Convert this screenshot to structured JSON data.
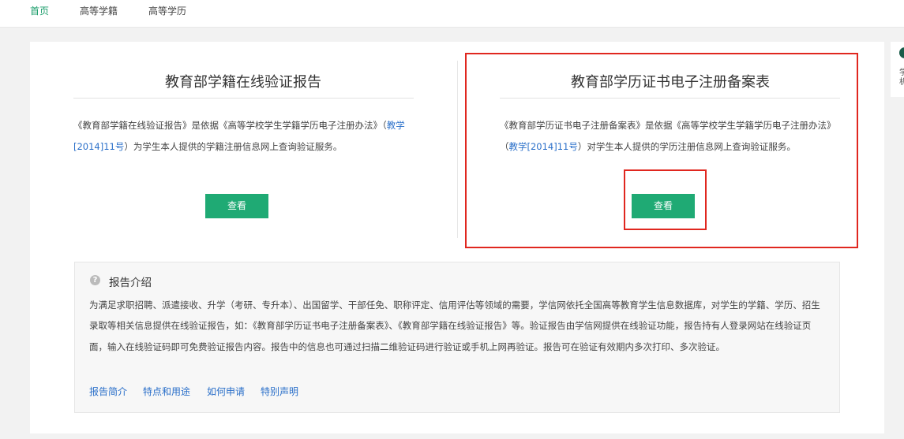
{
  "nav": {
    "items": [
      {
        "label": "首页"
      },
      {
        "label": "高等学籍"
      },
      {
        "label": "高等学历"
      }
    ],
    "active_color": "#1a9c6a"
  },
  "reports": {
    "left": {
      "title": "教育部学籍在线验证报告",
      "desc_pre": "《教育部学籍在线验证报告》是依据《高等学校学生学籍学历电子注册办法》（",
      "desc_link": "教学[2014]11号",
      "desc_post": "）为学生本人提供的学籍注册信息网上查询验证服务。",
      "button": "查看"
    },
    "right": {
      "title": "教育部学历证书电子注册备案表",
      "desc_pre": "《教育部学历证书电子注册备案表》是依据《高等学校学生学籍学历电子注册办法》（",
      "desc_link": "教学[2014]11号",
      "desc_post": "）对学生本人提供的学历注册信息网上查询验证服务。",
      "button": "查看"
    }
  },
  "intro": {
    "heading": "报告介绍",
    "icon": "question-circle-icon",
    "text": "为满足求职招聘、派遣接收、升学（考研、专升本）、出国留学、干部任免、职称评定、信用评估等领域的需要，学信网依托全国高等教育学生信息数据库，对学生的学籍、学历、招生录取等相关信息提供在线验证报告，如：《教育部学历证书电子注册备案表》、《教育部学籍在线验证报告》等。验证报告由学信网提供在线验证功能，报告持有人登录网站在线验证页面，输入在线验证码即可免费验证报告内容。报告中的信息也可通过扫描二维验证码进行验证或手机上网再验证。报告可在验证有效期内多次打印、多次验证。",
    "links": [
      {
        "label": "报告简介"
      },
      {
        "label": "特点和用途"
      },
      {
        "label": "如何申请"
      },
      {
        "label": "特别声明"
      }
    ]
  },
  "side_widget": {
    "text": "学机"
  },
  "colors": {
    "accent_green": "#1faa74",
    "link_blue": "#2a6fc9",
    "highlight_red": "#e0271f"
  }
}
